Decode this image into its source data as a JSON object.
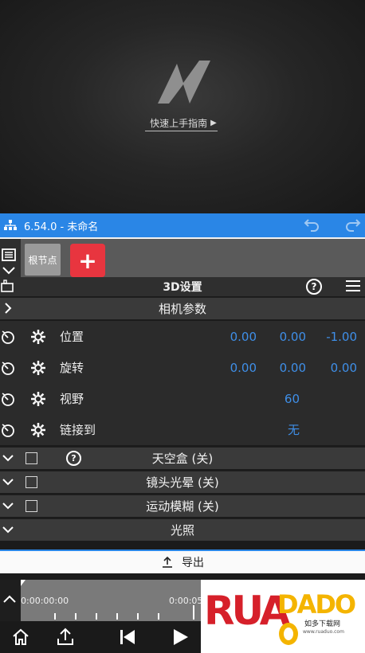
{
  "preview": {
    "guide_text": "快速上手指南",
    "guide_arrow": "▶"
  },
  "titlebar": {
    "title": "6.54.0 - 未命名",
    "undo_icon": "undo-icon",
    "redo_icon": "redo-icon",
    "color": "#2a86e6"
  },
  "nodebar": {
    "root_node_label": "根节点",
    "add_label": "+",
    "add_color": "#e8353f"
  },
  "settings": {
    "title": "3D设置",
    "help_label": "?"
  },
  "camera_section": {
    "label": "相机参数",
    "props": [
      {
        "name": "位置",
        "values": [
          "0.00",
          "0.00",
          "-1.00"
        ]
      },
      {
        "name": "旋转",
        "values": [
          "0.00",
          "0.00",
          "0.00"
        ]
      },
      {
        "name": "视野",
        "values": [
          "60"
        ]
      },
      {
        "name": "链接到",
        "values": [
          "无"
        ]
      }
    ]
  },
  "sections": {
    "skybox": "天空盒 (关)",
    "lens_flare": "镜头光晕 (关)",
    "motion_blur": "运动模糊 (关)",
    "lighting": "光照",
    "help_label": "?"
  },
  "export": {
    "label": "导出"
  },
  "timeline": {
    "start_time": "0:00:00:00",
    "next_time": "0:00:05"
  },
  "watermark": {
    "text": "如多下载网",
    "url": "www.ruaduo.com"
  },
  "value_color": "#3f8fe8"
}
